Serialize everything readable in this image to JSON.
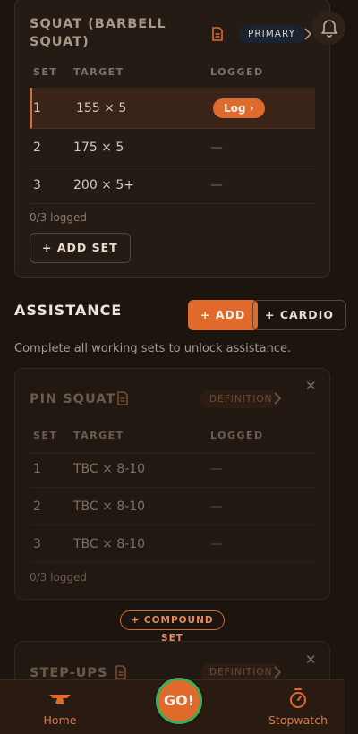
{
  "colors": {
    "accent": "#e06a2c",
    "background": "#1c140e",
    "go_ring": "#3cae5b"
  },
  "primary_exercise": {
    "title_line1": "SQUAT (BARBELL",
    "title_line2": "SQUAT)",
    "badge": "PRIMARY",
    "columns": {
      "set": "SET",
      "target": "TARGET",
      "logged": "LOGGED"
    },
    "rows": [
      {
        "set": "1",
        "target": "155 × 5",
        "logged": "Log ›"
      },
      {
        "set": "2",
        "target": "175 × 5",
        "logged": "—"
      },
      {
        "set": "3",
        "target": "200 × 5+",
        "logged": "—"
      }
    ],
    "logged_count": "0/3 logged",
    "add_set_label": "+ ADD SET"
  },
  "assistance": {
    "title": "ASSISTANCE",
    "add_label": "+ ADD",
    "cardio_label": "+ CARDIO",
    "hint": "Complete all working sets to unlock assistance.",
    "exercises": [
      {
        "title": "PIN SQUAT",
        "badge": "DEFINITION",
        "columns": {
          "set": "SET",
          "target": "TARGET",
          "logged": "LOGGED"
        },
        "rows": [
          {
            "set": "1",
            "target": "TBC × 8-10",
            "logged": "—"
          },
          {
            "set": "2",
            "target": "TBC × 8-10",
            "logged": "—"
          },
          {
            "set": "3",
            "target": "TBC × 8-10",
            "logged": "—"
          }
        ],
        "logged_count": "0/3 logged"
      },
      {
        "title": "STEP-UPS",
        "badge": "DEFINITION"
      }
    ],
    "compound_set_label": "+ COMPOUND SET"
  },
  "icons": [
    "document-icon",
    "chevron-right-icon",
    "bell-icon",
    "close-icon",
    "barbell-icon",
    "stopwatch-icon"
  ],
  "bottom_nav": {
    "home_label": "Home",
    "go_label": "GO!",
    "stopwatch_label": "Stopwatch"
  }
}
